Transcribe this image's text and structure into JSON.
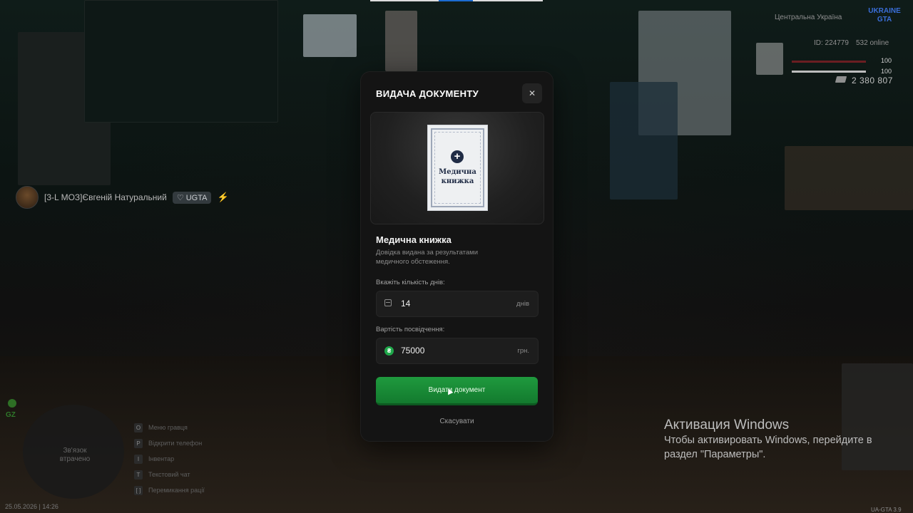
{
  "hud": {
    "player_name": "[3-L МОЗ]Євгеній Натуральний",
    "player_badge": "♡ UGTA",
    "region": "Центральна Україна",
    "logo_text": "UKRAINE GTA",
    "id_text": "ID: 224779",
    "online_text": "532 online",
    "health_value": "100",
    "armor_value": "100",
    "money": "2 380 807",
    "zone_label": "GZ",
    "minimap_text": "Зв'язок втрачено",
    "keybinds": [
      {
        "key": "O",
        "label": "Меню гравця"
      },
      {
        "key": "P",
        "label": "Відкрити телефон"
      },
      {
        "key": "I",
        "label": "Інвентар"
      },
      {
        "key": "T",
        "label": "Текстовий чат"
      },
      {
        "key": "[ ]",
        "label": "Перемикання рації"
      }
    ],
    "datetime": "25.05.2026 | 14:26",
    "version": "UA-GTA 3.9"
  },
  "modal": {
    "title": "ВИДАЧА ДОКУМЕНТУ",
    "close_label": "✕",
    "preview_doc_title": "Медична книжка",
    "doc_name": "Медична книжка",
    "doc_description": "Довідка видана за результатами медичного обстеження.",
    "days_label": "Вкажіть кількість днів:",
    "days_value": "14",
    "days_unit": "днів",
    "cost_label": "Вартість посвідчення:",
    "cost_value": "75000",
    "cost_unit": "грн.",
    "issue_button": "Видати документ",
    "cancel_button": "Скасувати"
  },
  "windows_activation": {
    "title": "Активация Windows",
    "text": "Чтобы активировать Windows, перейдите в раздел \"Параметры\"."
  },
  "colors": {
    "accent_green": "#1f9a3e",
    "modal_bg": "#141414"
  }
}
